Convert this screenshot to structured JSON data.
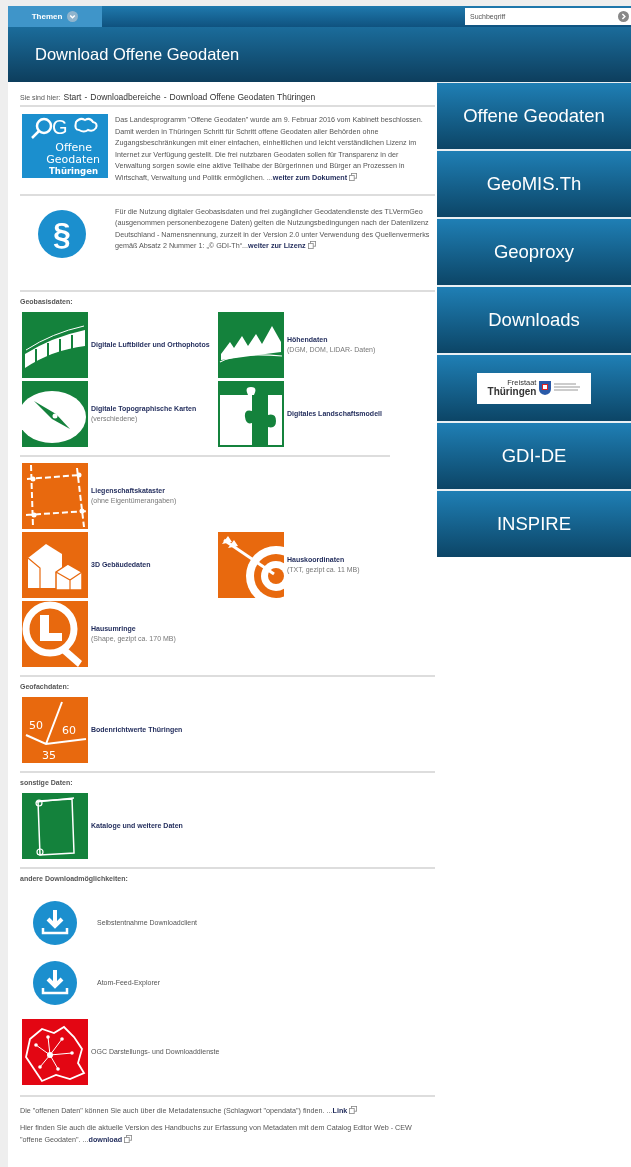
{
  "top_bar": {
    "menu_tab": "Themen",
    "search": {
      "placeholder": "Suchbegriff"
    }
  },
  "header": {
    "title": "Download Offene Geodaten"
  },
  "breadcrumb": {
    "label": "Sie sind hier:",
    "separator": "-",
    "items": [
      "Start",
      "Downloadbereiche",
      "Download Offene Geodaten Thüringen"
    ]
  },
  "intro": [
    {
      "kind": "og-logo",
      "logo_mark": "G",
      "logo_lines": [
        "Offene",
        "Geodaten",
        "Thüringen"
      ],
      "text": "Das Landesprogramm \"Offene Geodaten\" wurde am 9. Februar 2016 vom Kabinett beschlossen. Damit werden in Thüringen Schritt für Schritt offene Geodaten aller Behörden ohne Zugangsbeschränkungen mit einer einfachen, einheitlichen und leicht verständlichen Lizenz im Internet zur Verfügung gestellt. Die frei nutzbaren Geodaten sollen für Transparenz in der Verwaltung sorgen sowie eine aktive Teilhabe der Bürgerinnen und Bürger an Prozessen in Wirtschaft, Verwaltung und Politik ermöglichen. ...",
      "link": "weiter zum Dokument"
    },
    {
      "kind": "paragraph-sign",
      "sign": "§",
      "text": "Für die Nutzung digitaler Geobasisdaten und frei zugänglicher Geodatendienste des TLVermGeo (ausgenommen personenbezogene Daten) gelten die Nutzungsbedingungen nach der Datenlizenz Deutschland - Namensnennung, zurzeit in der Version 2.0 unter Verwendung des Quellenvermerks gemäß Absatz 2 Nummer 1: „© GDI-Th“...",
      "link": "weiter zur Lizenz"
    }
  ],
  "sections": [
    {
      "heading": "Geobasisdaten:",
      "groups": [
        {
          "rows": [
            [
              {
                "kind": "film",
                "color": "#14823c",
                "title": "Digitale Luftbilder und Orthophotos"
              },
              {
                "kind": "mountains",
                "color": "#14823c",
                "title": "Höhendaten",
                "subtitle": "(DGM, DOM, LiDAR- Daten)"
              }
            ],
            [
              {
                "kind": "compass",
                "color": "#14823c",
                "title": "Digitale Topographische Karten",
                "subtitle": "(verschiedene)"
              },
              {
                "kind": "puzzle",
                "color": "#14823c",
                "title": "Digitales Landschaftsmodell"
              }
            ]
          ]
        },
        {
          "rows": [
            [
              {
                "kind": "parcel",
                "color": "#e8690e",
                "title": "Liegenschaftskataster",
                "subtitle": "(ohne Eigentümerangaben)"
              }
            ],
            [
              {
                "kind": "houses",
                "color": "#e8690e",
                "title": "3D Gebäudedaten"
              },
              {
                "kind": "target",
                "color": "#e8690e",
                "title": "Hauskoordinaten",
                "subtitle": "(TXT, gezipt ca. 11 MB)"
              }
            ],
            [
              {
                "kind": "outline",
                "color": "#e8690e",
                "title": "Hausumringe",
                "subtitle": "(Shape, gezipt ca. 170 MB)"
              }
            ]
          ]
        }
      ]
    },
    {
      "heading": "Geofachdaten:",
      "groups": [
        {
          "rows": [
            [
              {
                "kind": "values",
                "color": "#e8690e",
                "numbers": [
                  "50",
                  "60",
                  "35"
                ],
                "title": "Bodenrichtwerte Thüringen"
              }
            ]
          ]
        }
      ]
    },
    {
      "heading": "sonstige Daten:",
      "groups": [
        {
          "rows": [
            [
              {
                "kind": "scroll",
                "color": "#14823c",
                "title": "Kataloge  und weitere Daten"
              }
            ]
          ]
        }
      ]
    },
    {
      "heading": "andere Downloadmöglichkeiten:",
      "downloads": [
        {
          "kind": "download",
          "label": "Selbstentnahme Downloadclient"
        },
        {
          "kind": "download",
          "label": "Atom-Feed-Explorer"
        },
        {
          "kind": "network-map",
          "label": "OGC Darstellungs- und Downloaddienste"
        }
      ]
    }
  ],
  "footer": [
    {
      "text": "Die \"offenen Daten\" können Sie auch über die Metadatensuche (Schlagwort \"opendata\") finden. ...",
      "link": "Link"
    },
    {
      "text": "Hier finden Sie auch die aktuelle Version des Handbuchs zur Erfassung von Metadaten mit dem Catalog Editor Web - CEW \"offene Geodaten\". ...",
      "link": "download"
    }
  ],
  "sidebar": [
    {
      "kind": "text",
      "label": "Offene Geodaten"
    },
    {
      "kind": "text",
      "label": "GeoMIS.Th"
    },
    {
      "kind": "text",
      "label": "Geoproxy"
    },
    {
      "kind": "text",
      "label": "Downloads"
    },
    {
      "kind": "logo",
      "logo_lines": [
        "Freistaat",
        "Thüringen"
      ]
    },
    {
      "kind": "text",
      "label": "GDI-DE"
    },
    {
      "kind": "text",
      "label": "INSPIRE"
    }
  ]
}
